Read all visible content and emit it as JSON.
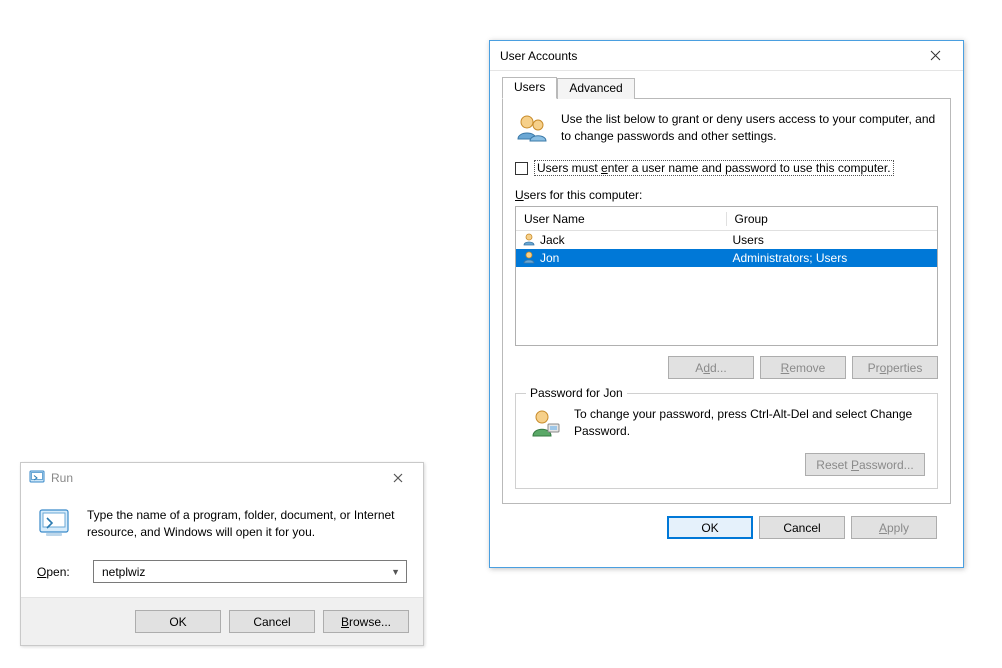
{
  "run_dialog": {
    "title": "Run",
    "description": "Type the name of a program, folder, document, or Internet resource, and Windows will open it for you.",
    "open_label": "Open:",
    "open_value": "netplwiz",
    "ok_label": "OK",
    "cancel_label": "Cancel",
    "browse_label": "Browse..."
  },
  "user_accounts": {
    "title": "User Accounts",
    "tabs": {
      "users": "Users",
      "advanced": "Advanced"
    },
    "info_text": "Use the list below to grant or deny users access to your computer, and to change passwords and other settings.",
    "checkbox_label": "Users must enter a user name and password to use this computer.",
    "checkbox_checked": false,
    "list_label_prefix": "U",
    "list_label_rest": "sers for this computer:",
    "columns": {
      "name": "User Name",
      "group": "Group"
    },
    "users_rows": [
      {
        "name": "Jack",
        "group": "Users",
        "selected": false
      },
      {
        "name": "Jon",
        "group": "Administrators; Users",
        "selected": true
      }
    ],
    "buttons": {
      "add": "Add...",
      "remove": "Remove",
      "properties": "Properties"
    },
    "password_box": {
      "title": "Password for Jon",
      "text": "To change your password, press Ctrl-Alt-Del and select Change Password.",
      "reset_label": "Reset Password...",
      "reset_underline": "P"
    },
    "footer": {
      "ok": "OK",
      "cancel": "Cancel",
      "apply": "Apply"
    }
  }
}
